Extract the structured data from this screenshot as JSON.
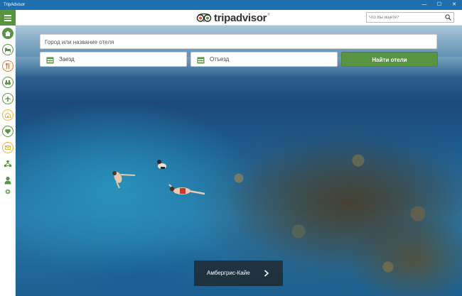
{
  "window": {
    "title": "TripAdvisor",
    "controls": {
      "minimize": "—",
      "maximize": "☐",
      "close": "✕"
    }
  },
  "header": {
    "logo_text": "tripadvisor",
    "logo_mark": "®",
    "search_placeholder": "Что Вы ищете?"
  },
  "sidebar": {
    "items": [
      {
        "icon": "home-icon",
        "active": true
      },
      {
        "icon": "bed-icon"
      },
      {
        "icon": "restaurant-icon"
      },
      {
        "icon": "binoculars-icon"
      },
      {
        "icon": "airplane-icon"
      },
      {
        "icon": "vacation-rental-icon"
      },
      {
        "icon": "heart-icon"
      },
      {
        "icon": "message-icon"
      },
      {
        "icon": "recent-icon"
      },
      {
        "icon": "user-icon"
      },
      {
        "icon": "gear-icon"
      }
    ]
  },
  "hotel_search": {
    "city_placeholder": "Город или название отеля",
    "checkin_label": "Заезд",
    "checkout_label": "Отъезд",
    "find_button": "Найти отели"
  },
  "hero": {
    "location_label": "Амбергрис-Кайе"
  },
  "colors": {
    "brand_green": "#589442",
    "titlebar_blue": "#1f6fae"
  }
}
